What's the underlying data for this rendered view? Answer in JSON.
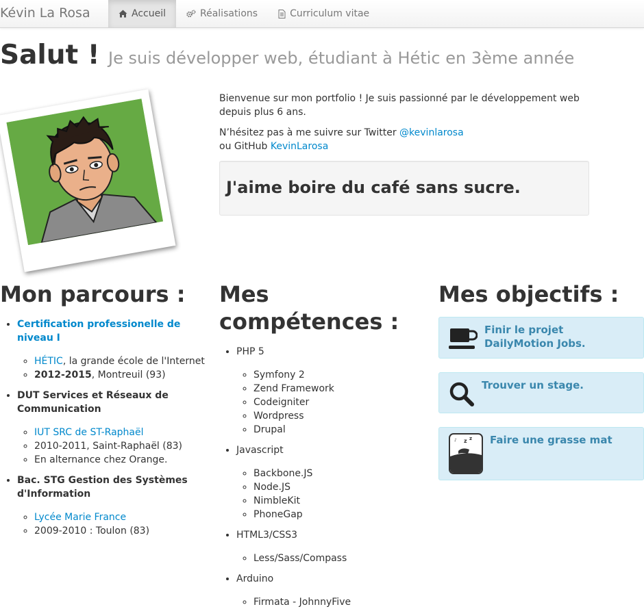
{
  "navbar": {
    "brand": "Kévin La Rosa",
    "items": [
      {
        "label": "Accueil",
        "icon": "home-icon",
        "active": true
      },
      {
        "label": "Réalisations",
        "icon": "cogs-icon",
        "active": false
      },
      {
        "label": "Curriculum vitae",
        "icon": "document-icon",
        "active": false
      }
    ]
  },
  "hero": {
    "title": "Salut !",
    "subtitle": "Je suis développer web, étudiant à Hétic en 3ème année"
  },
  "intro": {
    "welcome": "Bienvenue sur mon portfolio ! Je suis passionné par le développement web depuis plus 6 ans.",
    "follow_prefix": "N’hésitez pas à me suivre sur Twitter",
    "twitter_link": "@kevinlarosa",
    "github_prefix": "ou GitHub",
    "github_link": "KevinLarosa",
    "quote": "J'aime boire du café sans sucre."
  },
  "parcours": {
    "title": "Mon parcours :",
    "items": [
      {
        "title": "Certification professionelle de niveau I",
        "link": "HÉTIC",
        "link_suffix": ", la grande école de l'Internet",
        "years": "2012-2015",
        "place": ", Montreuil (93)"
      },
      {
        "title": "DUT Services et Réseaux de Communication",
        "link": "IUT SRC de ST-Raphaël",
        "line2": "2010-2011, Saint-Raphaël (83)",
        "line3": "En alternance chez Orange."
      },
      {
        "title": "Bac. STG Gestion des Systèmes d'Information",
        "link": "Lycée Marie France",
        "line2": "2009-2010 : Toulon (83)"
      }
    ]
  },
  "competences": {
    "title": "Mes compétences :",
    "groups": [
      {
        "name": "PHP 5",
        "items": [
          "Symfony 2",
          "Zend Framework",
          "Codeigniter",
          "Wordpress",
          "Drupal"
        ]
      },
      {
        "name": "Javascript",
        "items": [
          "Backbone.JS",
          "Node.JS",
          "NimbleKit",
          "PhoneGap"
        ]
      },
      {
        "name": "HTML3/CSS3",
        "items": [
          "Less/Sass/Compass"
        ]
      },
      {
        "name": "Arduino",
        "items": [
          "Firmata - JohnnyFive"
        ]
      }
    ]
  },
  "objectifs": {
    "title": "Mes objectifs :",
    "items": [
      {
        "text_line1": "Finir le projet",
        "text_line2": "DailyMotion Jobs.",
        "icon": "coffee-cup-icon"
      },
      {
        "text_line1": "Trouver un stage.",
        "icon": "search-icon"
      },
      {
        "text_line1": "Faire une grasse mat",
        "icon": "sleeping-icon"
      }
    ]
  },
  "colors": {
    "link": "#0088cc",
    "goal_background": "#d9edf7",
    "goal_text": "#3a87ad",
    "photo_background": "#66aa44"
  }
}
